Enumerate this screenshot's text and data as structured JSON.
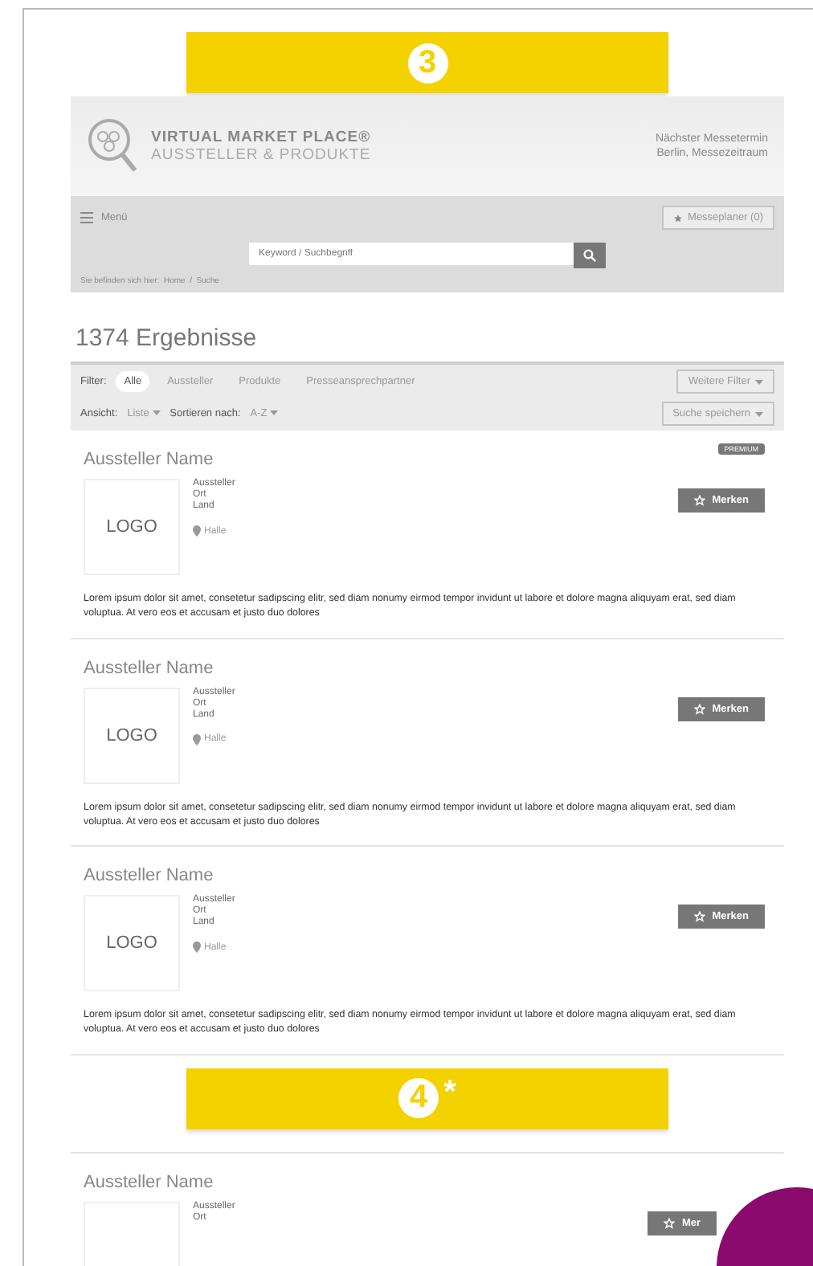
{
  "banners": [
    {
      "number": "3"
    },
    {
      "number": "4",
      "note": "*"
    }
  ],
  "header": {
    "brand_title": "VIRTUAL MARKET PLACE®",
    "brand_subtitle": "AUSSTELLER & PRODUKTE",
    "event_line_1": "Nächster Messetermin",
    "event_line_2": "Berlin, Messezeitraum"
  },
  "nav": {
    "menu_label": "Menü",
    "planner_label": "Messeplaner (0)",
    "search_placeholder": "Keyword / Suchbegriff",
    "breadcrumb": "Sie befinden sich hier:  Home  /  Suche"
  },
  "results_title": "1374 Ergebnisse",
  "filter": {
    "label": "Filter:",
    "tabs": [
      {
        "label": "Alle",
        "selected": true
      },
      {
        "label": "Aussteller",
        "selected": false
      },
      {
        "label": "Produkte",
        "selected": false
      },
      {
        "label": "Presseansprechpartner",
        "selected": false
      }
    ],
    "more_button": "Weitere Filter"
  },
  "view": {
    "view_label": "Ansicht:",
    "view_value": "Liste",
    "sort_label": "Sortieren nach:",
    "sort_value": "A-Z",
    "save_button": "Suche speichern"
  },
  "cards": [
    {
      "name": "Aussteller Name",
      "badge": "PREMIUM",
      "logo": "LOGO",
      "details": [
        "Aussteller",
        "Ort",
        "Land"
      ],
      "location": "Halle",
      "button": "Merken",
      "description": "Lorem ipsum dolor sit amet, consetetur sadipscing elitr, sed diam nonumy eirmod tempor invidunt ut labore et dolore magna aliquyam erat, sed diam voluptua. At vero eos et accusam et justo duo dolores"
    },
    {
      "name": "Aussteller Name",
      "logo": "LOGO",
      "details": [
        "Aussteller",
        "Ort",
        "Land"
      ],
      "location": "Halle",
      "button": "Merken",
      "description": "Lorem ipsum dolor sit amet, consetetur sadipscing elitr, sed diam nonumy eirmod tempor invidunt ut labore et dolore magna aliquyam erat, sed diam voluptua. At vero eos et accusam et justo duo dolores"
    },
    {
      "name": "Aussteller Name",
      "logo": "LOGO",
      "details": [
        "Aussteller",
        "Ort",
        "Land"
      ],
      "location": "Halle",
      "button": "Merken",
      "description": "Lorem ipsum dolor sit amet, consetetur sadipscing elitr, sed diam nonumy eirmod tempor invidunt ut labore et dolore magna aliquyam erat, sed diam voluptua. At vero eos et accusam et justo duo dolores"
    }
  ],
  "partial_card": {
    "name": "Aussteller Name",
    "details": [
      "Aussteller",
      "Ort"
    ],
    "button": "Mer"
  }
}
